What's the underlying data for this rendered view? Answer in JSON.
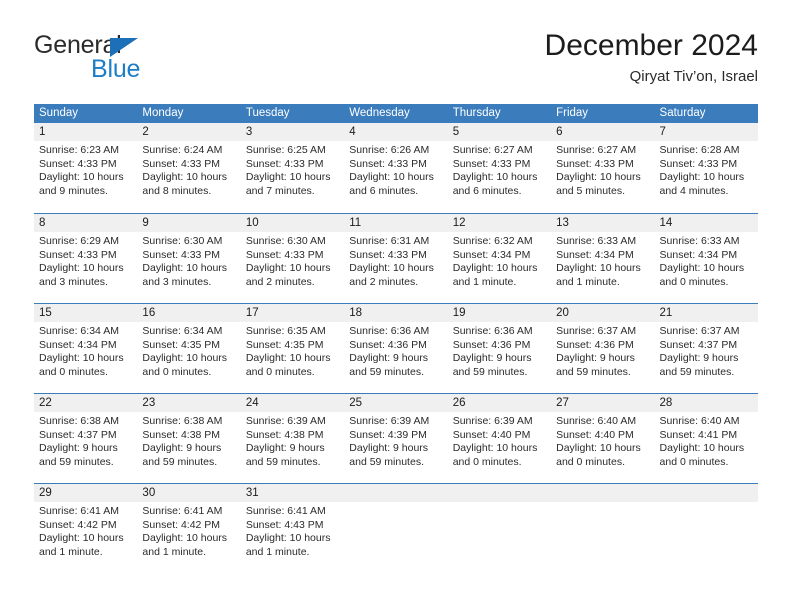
{
  "brand": {
    "name_part1": "General",
    "name_part2": "Blue",
    "triangle_icon": "blue-triangle-icon",
    "color_dark": "#2b2b2b",
    "color_blue": "#1d7ec8"
  },
  "header": {
    "title": "December 2024",
    "subtitle": "Qiryat Tiv’on, Israel"
  },
  "colors": {
    "header_row_bg": "#3b7cbd",
    "header_row_text": "#ffffff",
    "daynumber_bg": "#f0f0f0",
    "cell_bg": "#ffffff",
    "text": "#2b2b2b"
  },
  "weekdays": [
    "Sunday",
    "Monday",
    "Tuesday",
    "Wednesday",
    "Thursday",
    "Friday",
    "Saturday"
  ],
  "weeks": [
    {
      "days": [
        {
          "num": "1",
          "sunrise": "Sunrise: 6:23 AM",
          "sunset": "Sunset: 4:33 PM",
          "daylight1": "Daylight: 10 hours",
          "daylight2": "and 9 minutes."
        },
        {
          "num": "2",
          "sunrise": "Sunrise: 6:24 AM",
          "sunset": "Sunset: 4:33 PM",
          "daylight1": "Daylight: 10 hours",
          "daylight2": "and 8 minutes."
        },
        {
          "num": "3",
          "sunrise": "Sunrise: 6:25 AM",
          "sunset": "Sunset: 4:33 PM",
          "daylight1": "Daylight: 10 hours",
          "daylight2": "and 7 minutes."
        },
        {
          "num": "4",
          "sunrise": "Sunrise: 6:26 AM",
          "sunset": "Sunset: 4:33 PM",
          "daylight1": "Daylight: 10 hours",
          "daylight2": "and 6 minutes."
        },
        {
          "num": "5",
          "sunrise": "Sunrise: 6:27 AM",
          "sunset": "Sunset: 4:33 PM",
          "daylight1": "Daylight: 10 hours",
          "daylight2": "and 6 minutes."
        },
        {
          "num": "6",
          "sunrise": "Sunrise: 6:27 AM",
          "sunset": "Sunset: 4:33 PM",
          "daylight1": "Daylight: 10 hours",
          "daylight2": "and 5 minutes."
        },
        {
          "num": "7",
          "sunrise": "Sunrise: 6:28 AM",
          "sunset": "Sunset: 4:33 PM",
          "daylight1": "Daylight: 10 hours",
          "daylight2": "and 4 minutes."
        }
      ]
    },
    {
      "days": [
        {
          "num": "8",
          "sunrise": "Sunrise: 6:29 AM",
          "sunset": "Sunset: 4:33 PM",
          "daylight1": "Daylight: 10 hours",
          "daylight2": "and 3 minutes."
        },
        {
          "num": "9",
          "sunrise": "Sunrise: 6:30 AM",
          "sunset": "Sunset: 4:33 PM",
          "daylight1": "Daylight: 10 hours",
          "daylight2": "and 3 minutes."
        },
        {
          "num": "10",
          "sunrise": "Sunrise: 6:30 AM",
          "sunset": "Sunset: 4:33 PM",
          "daylight1": "Daylight: 10 hours",
          "daylight2": "and 2 minutes."
        },
        {
          "num": "11",
          "sunrise": "Sunrise: 6:31 AM",
          "sunset": "Sunset: 4:33 PM",
          "daylight1": "Daylight: 10 hours",
          "daylight2": "and 2 minutes."
        },
        {
          "num": "12",
          "sunrise": "Sunrise: 6:32 AM",
          "sunset": "Sunset: 4:34 PM",
          "daylight1": "Daylight: 10 hours",
          "daylight2": "and 1 minute."
        },
        {
          "num": "13",
          "sunrise": "Sunrise: 6:33 AM",
          "sunset": "Sunset: 4:34 PM",
          "daylight1": "Daylight: 10 hours",
          "daylight2": "and 1 minute."
        },
        {
          "num": "14",
          "sunrise": "Sunrise: 6:33 AM",
          "sunset": "Sunset: 4:34 PM",
          "daylight1": "Daylight: 10 hours",
          "daylight2": "and 0 minutes."
        }
      ]
    },
    {
      "days": [
        {
          "num": "15",
          "sunrise": "Sunrise: 6:34 AM",
          "sunset": "Sunset: 4:34 PM",
          "daylight1": "Daylight: 10 hours",
          "daylight2": "and 0 minutes."
        },
        {
          "num": "16",
          "sunrise": "Sunrise: 6:34 AM",
          "sunset": "Sunset: 4:35 PM",
          "daylight1": "Daylight: 10 hours",
          "daylight2": "and 0 minutes."
        },
        {
          "num": "17",
          "sunrise": "Sunrise: 6:35 AM",
          "sunset": "Sunset: 4:35 PM",
          "daylight1": "Daylight: 10 hours",
          "daylight2": "and 0 minutes."
        },
        {
          "num": "18",
          "sunrise": "Sunrise: 6:36 AM",
          "sunset": "Sunset: 4:36 PM",
          "daylight1": "Daylight: 9 hours",
          "daylight2": "and 59 minutes."
        },
        {
          "num": "19",
          "sunrise": "Sunrise: 6:36 AM",
          "sunset": "Sunset: 4:36 PM",
          "daylight1": "Daylight: 9 hours",
          "daylight2": "and 59 minutes."
        },
        {
          "num": "20",
          "sunrise": "Sunrise: 6:37 AM",
          "sunset": "Sunset: 4:36 PM",
          "daylight1": "Daylight: 9 hours",
          "daylight2": "and 59 minutes."
        },
        {
          "num": "21",
          "sunrise": "Sunrise: 6:37 AM",
          "sunset": "Sunset: 4:37 PM",
          "daylight1": "Daylight: 9 hours",
          "daylight2": "and 59 minutes."
        }
      ]
    },
    {
      "days": [
        {
          "num": "22",
          "sunrise": "Sunrise: 6:38 AM",
          "sunset": "Sunset: 4:37 PM",
          "daylight1": "Daylight: 9 hours",
          "daylight2": "and 59 minutes."
        },
        {
          "num": "23",
          "sunrise": "Sunrise: 6:38 AM",
          "sunset": "Sunset: 4:38 PM",
          "daylight1": "Daylight: 9 hours",
          "daylight2": "and 59 minutes."
        },
        {
          "num": "24",
          "sunrise": "Sunrise: 6:39 AM",
          "sunset": "Sunset: 4:38 PM",
          "daylight1": "Daylight: 9 hours",
          "daylight2": "and 59 minutes."
        },
        {
          "num": "25",
          "sunrise": "Sunrise: 6:39 AM",
          "sunset": "Sunset: 4:39 PM",
          "daylight1": "Daylight: 9 hours",
          "daylight2": "and 59 minutes."
        },
        {
          "num": "26",
          "sunrise": "Sunrise: 6:39 AM",
          "sunset": "Sunset: 4:40 PM",
          "daylight1": "Daylight: 10 hours",
          "daylight2": "and 0 minutes."
        },
        {
          "num": "27",
          "sunrise": "Sunrise: 6:40 AM",
          "sunset": "Sunset: 4:40 PM",
          "daylight1": "Daylight: 10 hours",
          "daylight2": "and 0 minutes."
        },
        {
          "num": "28",
          "sunrise": "Sunrise: 6:40 AM",
          "sunset": "Sunset: 4:41 PM",
          "daylight1": "Daylight: 10 hours",
          "daylight2": "and 0 minutes."
        }
      ]
    },
    {
      "days": [
        {
          "num": "29",
          "sunrise": "Sunrise: 6:41 AM",
          "sunset": "Sunset: 4:42 PM",
          "daylight1": "Daylight: 10 hours",
          "daylight2": "and 1 minute."
        },
        {
          "num": "30",
          "sunrise": "Sunrise: 6:41 AM",
          "sunset": "Sunset: 4:42 PM",
          "daylight1": "Daylight: 10 hours",
          "daylight2": "and 1 minute."
        },
        {
          "num": "31",
          "sunrise": "Sunrise: 6:41 AM",
          "sunset": "Sunset: 4:43 PM",
          "daylight1": "Daylight: 10 hours",
          "daylight2": "and 1 minute."
        },
        {
          "num": "",
          "sunrise": "",
          "sunset": "",
          "daylight1": "",
          "daylight2": ""
        },
        {
          "num": "",
          "sunrise": "",
          "sunset": "",
          "daylight1": "",
          "daylight2": ""
        },
        {
          "num": "",
          "sunrise": "",
          "sunset": "",
          "daylight1": "",
          "daylight2": ""
        },
        {
          "num": "",
          "sunrise": "",
          "sunset": "",
          "daylight1": "",
          "daylight2": ""
        }
      ]
    }
  ]
}
